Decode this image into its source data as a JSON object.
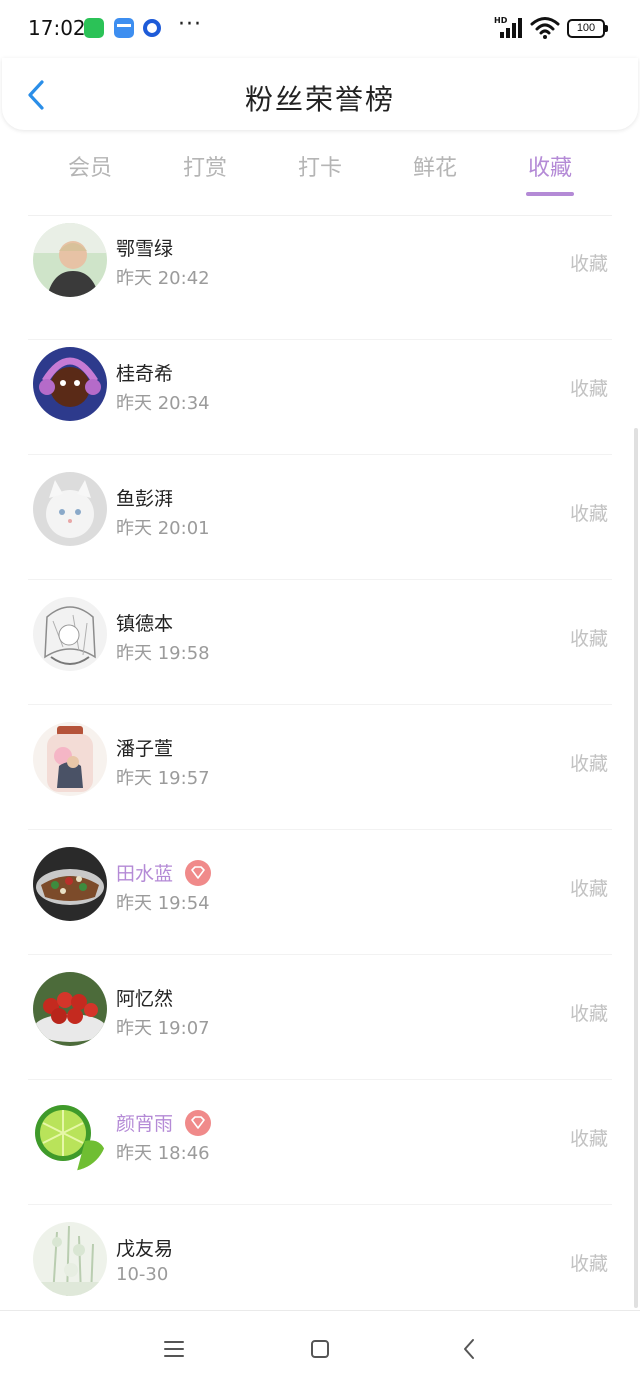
{
  "status_bar": {
    "time": "17:02",
    "network_label": "HD",
    "battery": "100",
    "icons": [
      "wechat-icon",
      "card-icon",
      "circle-app-icon",
      "more-dots-icon",
      "signal-icon",
      "wifi-icon",
      "battery-icon"
    ]
  },
  "header": {
    "title": "粉丝荣誉榜",
    "back_icon": "chevron-left-icon"
  },
  "tabs": [
    {
      "label": "会员",
      "active": false
    },
    {
      "label": "打赏",
      "active": false
    },
    {
      "label": "打卡",
      "active": false
    },
    {
      "label": "鲜花",
      "active": false
    },
    {
      "label": "收藏",
      "active": true
    }
  ],
  "accent_color": "#b48ad6",
  "vip_badge_color": "#f08a8a",
  "list": [
    {
      "name": "鄂雪绿",
      "time": "昨天 20:42",
      "action": "收藏",
      "vip": false,
      "avatar": "photo-avatar"
    },
    {
      "name": "桂奇希",
      "time": "昨天 20:34",
      "action": "收藏",
      "vip": false,
      "avatar": "photo-avatar"
    },
    {
      "name": "鱼彭湃",
      "time": "昨天 20:01",
      "action": "收藏",
      "vip": false,
      "avatar": "photo-avatar"
    },
    {
      "name": "镇德本",
      "time": "昨天 19:58",
      "action": "收藏",
      "vip": false,
      "avatar": "photo-avatar"
    },
    {
      "name": "潘子萱",
      "time": "昨天 19:57",
      "action": "收藏",
      "vip": false,
      "avatar": "photo-avatar"
    },
    {
      "name": "田水蓝",
      "time": "昨天 19:54",
      "action": "收藏",
      "vip": true,
      "avatar": "photo-avatar"
    },
    {
      "name": "阿忆然",
      "time": "昨天 19:07",
      "action": "收藏",
      "vip": false,
      "avatar": "photo-avatar"
    },
    {
      "name": "颜宵雨",
      "time": "昨天 18:46",
      "action": "收藏",
      "vip": true,
      "avatar": "photo-avatar"
    },
    {
      "name": "戊友易",
      "time": "10-30",
      "action": "收藏",
      "vip": false,
      "avatar": "photo-avatar"
    }
  ],
  "nav_bar": {
    "icons": [
      "menu-icon",
      "home-square-icon",
      "back-triangle-icon"
    ]
  }
}
